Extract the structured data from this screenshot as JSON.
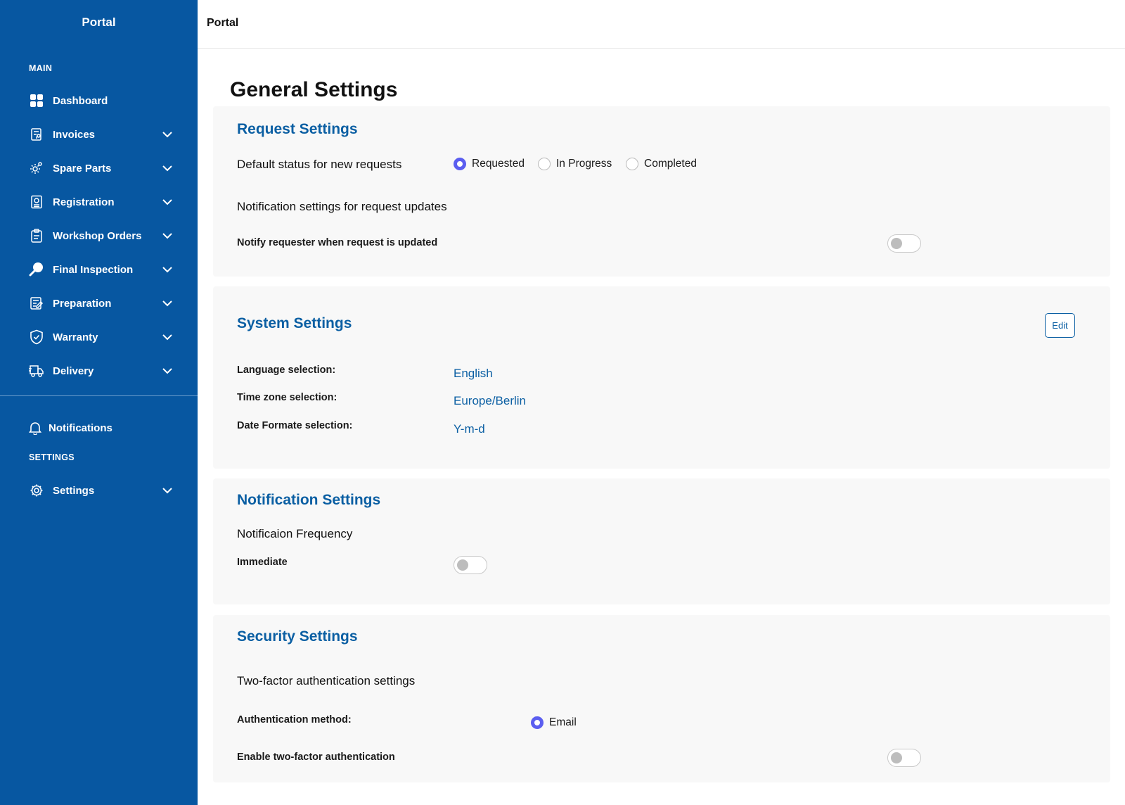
{
  "sidebar": {
    "brand": "Portal",
    "main_label": "MAIN",
    "items": [
      {
        "label": "Dashboard",
        "icon": "dashboard-grid-icon"
      },
      {
        "label": "Invoices",
        "icon": "invoice-icon"
      },
      {
        "label": "Spare Parts",
        "icon": "gear-parts-icon"
      },
      {
        "label": "Registration",
        "icon": "registration-icon"
      },
      {
        "label": "Workshop Orders",
        "icon": "clipboard-icon"
      },
      {
        "label": "Final Inspection",
        "icon": "magnifier-icon"
      },
      {
        "label": "Preparation",
        "icon": "checklist-icon"
      },
      {
        "label": "Warranty",
        "icon": "shield-icon"
      },
      {
        "label": "Delivery",
        "icon": "truck-icon"
      }
    ],
    "notifications_label": "Notifications",
    "settings_section_label": "SETTINGS",
    "settings_label": "Settings"
  },
  "topbar": {
    "title": "Portal"
  },
  "page": {
    "title": "General Settings"
  },
  "request_settings": {
    "title": "Request Settings",
    "default_status_label": "Default status for new requests",
    "status_options": [
      "Requested",
      "In Progress",
      "Completed"
    ],
    "selected_status": "Requested",
    "notification_heading": "Notification settings for request updates",
    "notify_label": "Notify requester when request is updated",
    "notify_enabled": false
  },
  "system_settings": {
    "title": "System Settings",
    "edit_label": "Edit",
    "language_label": "Language selection:",
    "language_value": "English",
    "timezone_label": "Time zone selection:",
    "timezone_value": "Europe/Berlin",
    "date_format_label": "Date Formate selection:",
    "date_format_value": "Y-m-d"
  },
  "notification_settings": {
    "title": "Notification Settings",
    "frequency_heading": "Notificaion Frequency",
    "immediate_label": "Immediate",
    "immediate_enabled": false
  },
  "security_settings": {
    "title": "Security Settings",
    "two_factor_heading": "Two-factor authentication settings",
    "auth_method_label": "Authentication method:",
    "auth_method_value": "Email",
    "enable_2fa_label": "Enable two-factor authentication",
    "enable_2fa_enabled": false
  },
  "colors": {
    "sidebar_bg": "#0757a1",
    "accent_blue": "#0b5fa3",
    "radio_accent": "#5b5ef0",
    "card_bg": "#f8f8f8"
  }
}
